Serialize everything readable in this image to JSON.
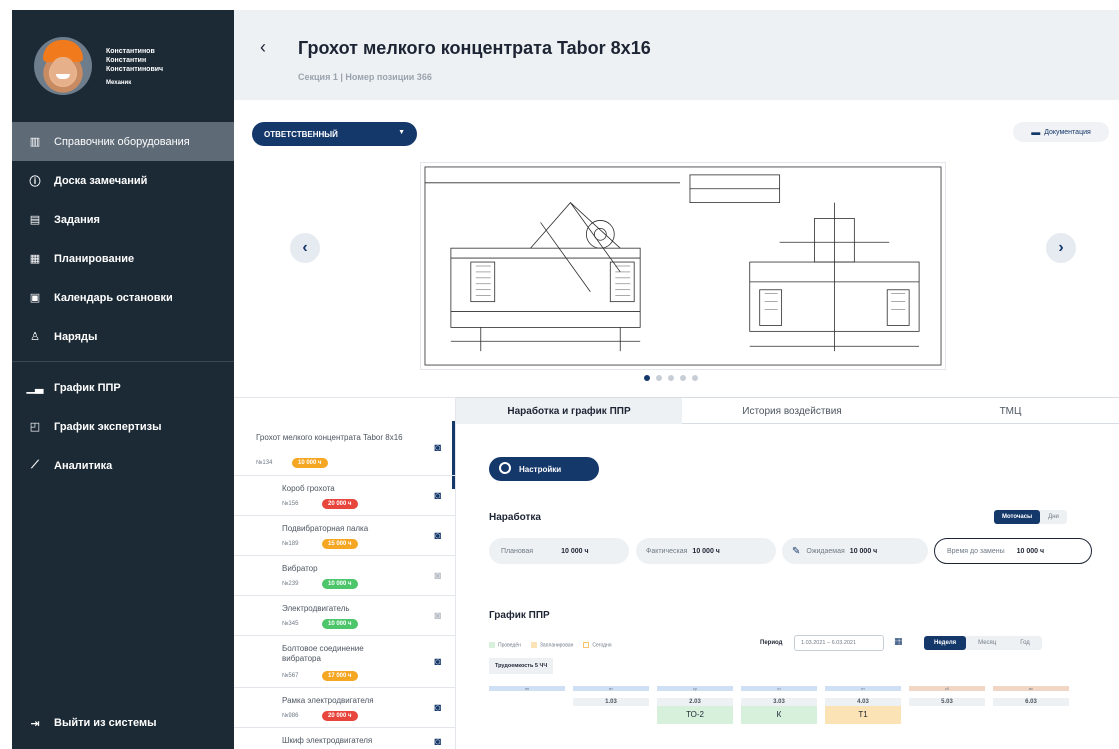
{
  "user": {
    "name": "Константинов Константин Константинович",
    "role": "Механик"
  },
  "sidebar": {
    "items": [
      {
        "label": "Справочник оборудования",
        "icon": "catalog-icon"
      },
      {
        "label": "Доска замечаний",
        "icon": "alert-circle-icon"
      },
      {
        "label": "Задания",
        "icon": "clipboard-icon"
      },
      {
        "label": "Планирование",
        "icon": "planning-grid-icon"
      },
      {
        "label": "Календарь остановки",
        "icon": "calendar-icon"
      },
      {
        "label": "Наряды",
        "icon": "person-icon"
      }
    ],
    "items2": [
      {
        "label": "График ППР",
        "icon": "bar-chart-icon"
      },
      {
        "label": "График экспертизы",
        "icon": "expertise-icon"
      },
      {
        "label": "Аналитика",
        "icon": "line-chart-icon"
      }
    ],
    "logout_label": "Выйти из системы"
  },
  "header": {
    "back_glyph": "‹",
    "title": "Грохот мелкого концентрата Tabor 8х16",
    "subtitle": "Секция 1 | Номер позиции 366"
  },
  "gallery": {
    "responsible_label": "ОТВЕТСТВЕННЫЙ",
    "documentation_label": "Документация",
    "dot_count": 5,
    "active_dot": 0
  },
  "components": [
    {
      "name": "Грохот мелкого концентрата Tabor 8х16",
      "num": "№134",
      "badge": "10 000 ч",
      "badge_color": "#f5a623",
      "camera": "active"
    },
    {
      "name": "Короб грохота",
      "num": "№156",
      "badge": "20 000 ч",
      "badge_color": "#e8453c",
      "camera": "active"
    },
    {
      "name": "Подвибраторная палка",
      "num": "№189",
      "badge": "15 000 ч",
      "badge_color": "#f5a623",
      "camera": "active"
    },
    {
      "name": "Вибратор",
      "num": "№239",
      "badge": "10 000 ч",
      "badge_color": "#4cc56b",
      "camera": "inactive"
    },
    {
      "name": "Электродвигатель",
      "num": "№345",
      "badge": "10 000 ч",
      "badge_color": "#4cc56b",
      "camera": "inactive"
    },
    {
      "name": "Болтовое соединение вибратора",
      "num": "№567",
      "badge": "17 000 ч",
      "badge_color": "#f5a623",
      "camera": "active"
    },
    {
      "name": "Рамка электродвигателя",
      "num": "№986",
      "badge": "20 000 ч",
      "badge_color": "#e8453c",
      "camera": "active"
    },
    {
      "name": "Шкиф электродвигателя",
      "num": "",
      "badge": "",
      "badge_color": "#e8453c",
      "camera": "active"
    }
  ],
  "tabs": [
    "Наработка и график ППР",
    "История воздействия",
    "ТМЦ"
  ],
  "panel": {
    "settings_label": "Настройки",
    "operating_title": "Наработка",
    "unit_toggle": [
      "Моточасы",
      "Дни"
    ],
    "planned_label": "Плановая",
    "planned_value": "10 000 ч",
    "actual_label": "Фактическая",
    "actual_value": "10 000 ч",
    "expected_label": "Ожидаемая",
    "expected_value": "10 000 ч",
    "replace_label": "Время до замены",
    "replace_value": "10 000 ч",
    "ppr_title": "График ППР",
    "legend": [
      {
        "label": "Проведён",
        "color": "#d6f0dc"
      },
      {
        "label": "Запланирован",
        "color": "#fbe3b5"
      },
      {
        "label": "Сегодня",
        "color": "#fbe3b5"
      }
    ],
    "period_label": "Период",
    "period_value": "1.03.2021 – 6.03.2021",
    "range_toggle": [
      "Неделя",
      "Месяц",
      "Год"
    ],
    "effort_label": "Трудоемкость 5 ЧЧ",
    "days": [
      {
        "head": "пн",
        "date": "",
        "event": "",
        "color": "#ffffff",
        "head_color": "#cfe0f5"
      },
      {
        "head": "вт",
        "date": "1.03",
        "event": "",
        "color": "#ffffff",
        "head_color": "#cfe0f5"
      },
      {
        "head": "ср",
        "date": "2.03",
        "event": "ТО-2",
        "color": "#d6f0dc",
        "head_color": "#cfe0f5"
      },
      {
        "head": "чт",
        "date": "3.03",
        "event": "К",
        "color": "#d6f0dc",
        "head_color": "#cfe0f5"
      },
      {
        "head": "пт",
        "date": "4.03",
        "event": "Т1",
        "color": "#fbe3b5",
        "head_color": "#cfe0f5"
      },
      {
        "head": "сб",
        "date": "5.03",
        "event": "",
        "color": "#ffffff",
        "head_color": "#f2d6c5"
      },
      {
        "head": "вс",
        "date": "6.03",
        "event": "",
        "color": "#ffffff",
        "head_color": "#f2d6c5"
      }
    ]
  }
}
